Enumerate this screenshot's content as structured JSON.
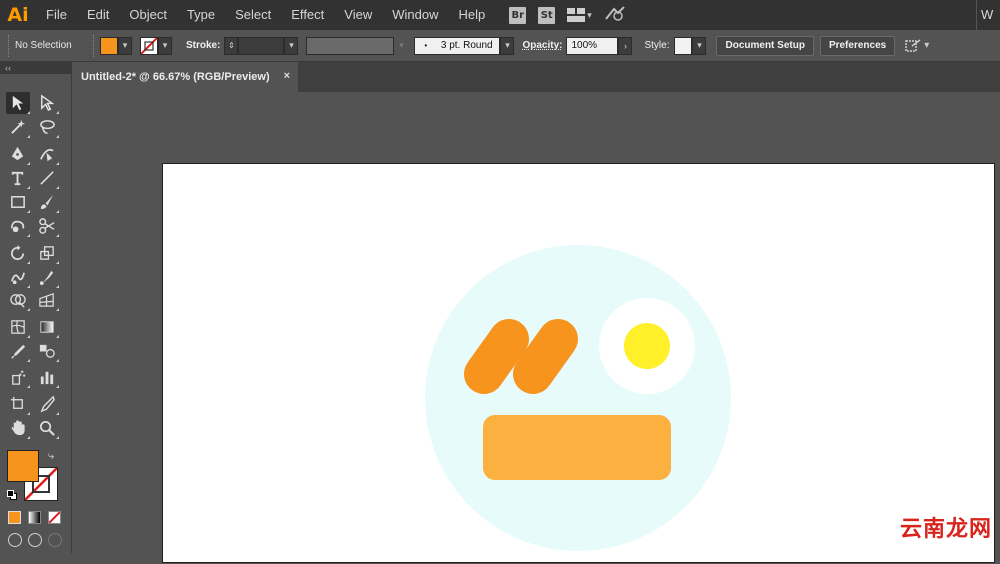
{
  "app": {
    "logo": "Ai"
  },
  "menubar": {
    "items": [
      "File",
      "Edit",
      "Object",
      "Type",
      "Select",
      "Effect",
      "View",
      "Window",
      "Help"
    ],
    "bridge_badge": "Br",
    "stock_badge": "St",
    "workspace_label": "W"
  },
  "controlbar": {
    "selection_status": "No Selection",
    "fill_color": "#f7941d",
    "stroke_label": "Stroke:",
    "brush_label": "3 pt. Round",
    "opacity_label": "Opacity:",
    "opacity_value": "100%",
    "style_label": "Style:",
    "document_setup": "Document Setup",
    "preferences": "Preferences"
  },
  "document": {
    "tab_title": "Untitled-2* @ 66.67% (RGB/Preview)",
    "close_glyph": "×"
  },
  "toolbar": {
    "collapse_glyph": "‹‹",
    "fill_color": "#f7941d",
    "stroke_color": "none",
    "tools": [
      "selection-tool",
      "direct-selection-tool",
      "magic-wand-tool",
      "lasso-tool",
      "pen-tool",
      "curvature-tool",
      "type-tool",
      "line-tool",
      "rectangle-tool",
      "paintbrush-tool",
      "shaper-tool",
      "scissors-tool",
      "rotate-tool",
      "scale-tool",
      "warp-tool",
      "puppet-warp-tool",
      "shape-builder-tool",
      "perspective-grid-tool",
      "mesh-tool",
      "gradient-tool",
      "eyedropper-tool",
      "blend-tool",
      "symbol-sprayer-tool",
      "column-graph-tool",
      "artboard-tool",
      "slice-tool",
      "hand-tool",
      "zoom-tool"
    ]
  },
  "artwork": {
    "face_color": "#e8fbfb",
    "bar_color": "#f7941d",
    "mouth_color": "#fbb040",
    "eye_white": "#ffffff",
    "eye_yolk": "#fff02a"
  },
  "watermark": "云南龙网"
}
